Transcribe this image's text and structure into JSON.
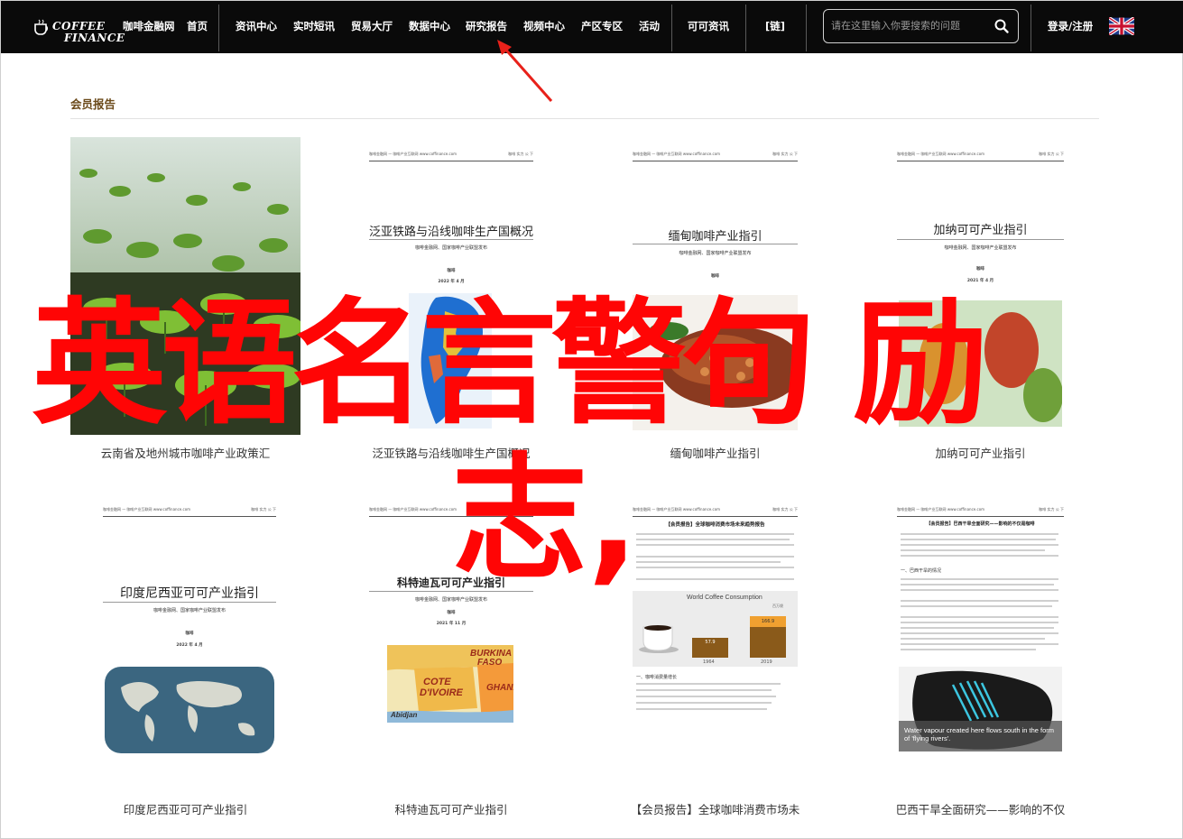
{
  "nav": {
    "logo_line1": "COFFEE",
    "logo_line2": "FINANCE",
    "items": [
      {
        "label": "咖啡金融网"
      },
      {
        "label": "首页"
      },
      {
        "label": "资讯中心"
      },
      {
        "label": "实时短讯"
      },
      {
        "label": "贸易大厅"
      },
      {
        "label": "数据中心"
      },
      {
        "label": "研究报告"
      },
      {
        "label": "视频中心"
      },
      {
        "label": "产区专区"
      },
      {
        "label": "活动"
      },
      {
        "label": "可可资讯"
      },
      {
        "label": "[链]"
      }
    ],
    "search_placeholder": "请在这里输入你要搜索的问题",
    "login_label": "登录/注册"
  },
  "section": {
    "title": "会员报告"
  },
  "reports": [
    {
      "caption": "云南省及地州城市咖啡产业政策汇"
    },
    {
      "caption": "泛亚铁路与沿线咖啡生产国概况",
      "doc_title": "泛亚铁路与沿线咖啡生产国概况",
      "doc_sub": "咖啡金融网、国家咖啡产业联盟发布",
      "doc_small1": "咖啡",
      "doc_small2": "2022 年 4 月",
      "head_left": "咖啡金融网 — 咖啡产业互联网 www.coffinance.com",
      "head_right": "咖啡   实力   公   下"
    },
    {
      "caption": "缅甸咖啡产业指引",
      "doc_title": "缅甸咖啡产业指引",
      "doc_sub": "咖啡金融网、国家咖啡产业联盟发布",
      "doc_small1": "咖啡",
      "head_left": "咖啡金融网 — 咖啡产业互联网 www.coffinance.com",
      "head_right": "咖啡   实力   公   下"
    },
    {
      "caption": "加纳可可产业指引",
      "doc_title": "加纳可可产业指引",
      "doc_sub": "咖啡金融网、国家咖啡产业联盟发布",
      "doc_small1": "咖啡",
      "doc_small2": "2021 年 4 月",
      "head_left": "咖啡金融网 — 咖啡产业互联网 www.coffinance.com",
      "head_right": "咖啡   实力   公   下"
    },
    {
      "caption": "印度尼西亚可可产业指引",
      "doc_title": "印度尼西亚可可产业指引",
      "doc_sub": "咖啡金融网、国家咖啡产业联盟发布",
      "doc_small1": "咖啡",
      "doc_small2": "2022 年 4 月",
      "head_left": "咖啡金融网 — 咖啡产业互联网 www.coffinance.com",
      "head_right": "咖啡   实力   公   下"
    },
    {
      "caption": "科特迪瓦可可产业指引",
      "doc_title": "科特迪瓦可可产业指引",
      "doc_sub": "咖啡金融网、国家咖啡产业联盟发布",
      "doc_small1": "咖啡",
      "doc_small2": "2021 年 11 月",
      "map_text": [
        "BURKINA",
        "FASO",
        "COTE",
        "D'IVOIRE",
        "GHANA",
        "Abidjan"
      ],
      "head_left": "咖啡金融网 — 咖啡产业互联网 www.coffinance.com",
      "head_right": "咖啡   实力   公   下"
    },
    {
      "caption": "【会员报告】全球咖啡消费市场未",
      "doc_title": "【会员报告】全球咖啡消费市场未来趋势报告",
      "chart_title": "World Coffee Consumption",
      "chart_unit": "百万袋",
      "chart_values": [
        "57.9",
        "166.9"
      ],
      "chart_years": [
        "1964",
        "2019"
      ],
      "section_label": "一、咖啡消费量增长",
      "head_left": "咖啡金融网 — 咖啡产业互联网 www.coffinance.com",
      "head_right": "咖啡   实力   公   下"
    },
    {
      "caption": "巴西干旱全面研究——影响的不仅",
      "doc_title": "【会员报告】巴西干旱全面研究——影响的不仅是咖啡",
      "section_label": "一、巴西干旱的情况",
      "photo_caption": "Water vapour created here flows south in the form of 'flying rivers'.",
      "head_left": "咖啡金融网 — 咖啡产业互联网 www.coffinance.com",
      "head_right": "咖啡   实力   公   下"
    }
  ],
  "overlay": {
    "line1": "英语名言警句 励",
    "line2": "志,"
  },
  "colors": {
    "nav_bg": "#0a0a0a",
    "overlay_red": "#ff0505",
    "section_brown": "#6b4a1a",
    "arrow_red": "#e8211a"
  }
}
